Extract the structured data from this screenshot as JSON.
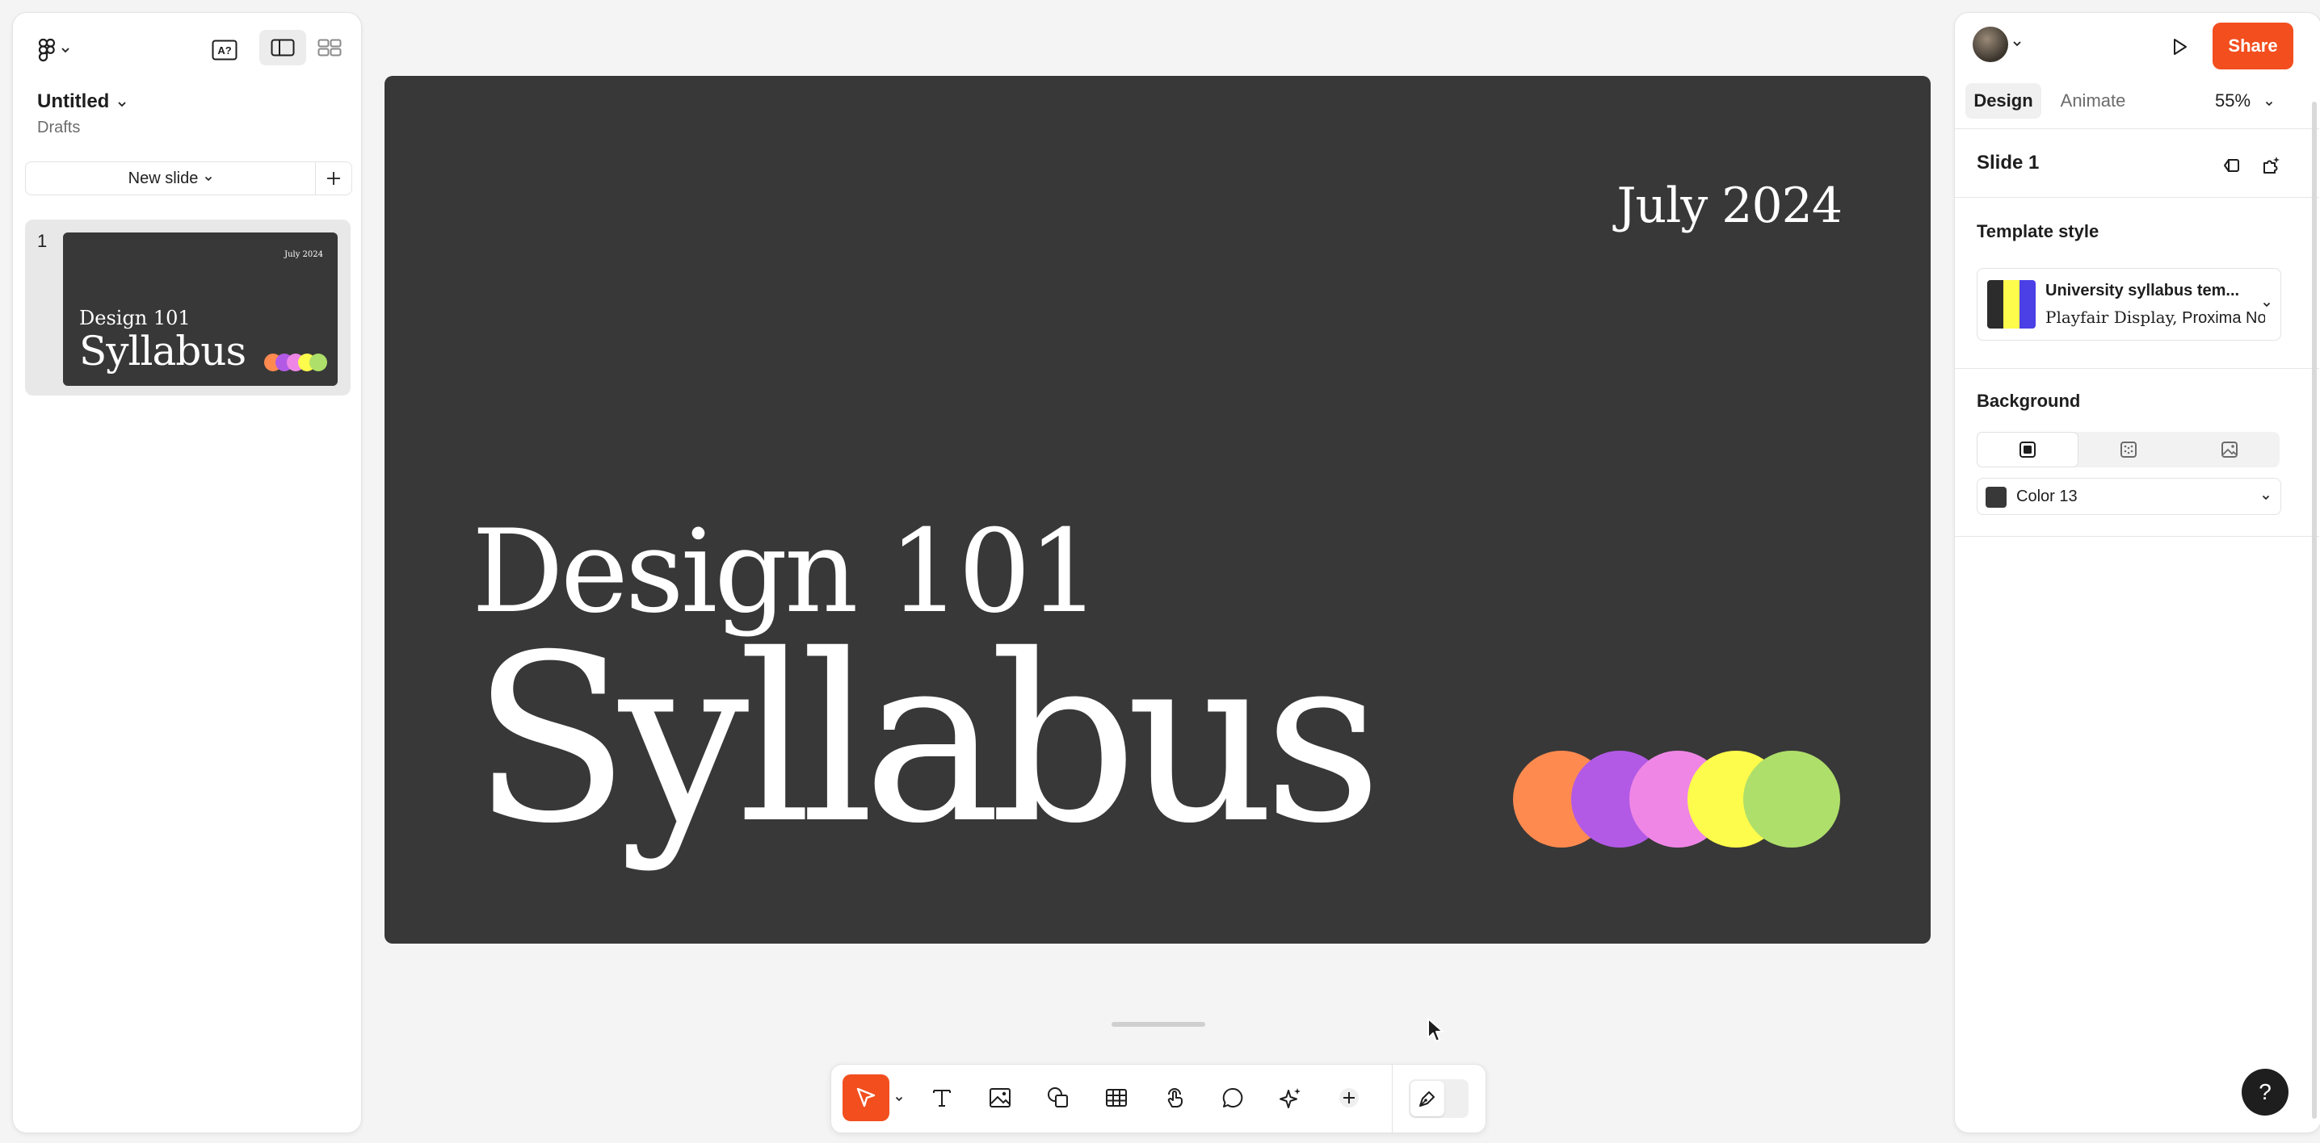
{
  "file": {
    "title": "Untitled",
    "location": "Drafts"
  },
  "left_panel": {
    "new_slide_label": "New slide",
    "slides": [
      {
        "number": "1",
        "date": "July 2024",
        "line1": "Design 101",
        "line2": "Syllabus"
      }
    ]
  },
  "slide": {
    "date": "July 2024",
    "line1": "Design 101",
    "line2": "Syllabus",
    "background": "#383838",
    "dot_colors": [
      "#ff8a50",
      "#b25ae6",
      "#ef86e6",
      "#fdfb4b",
      "#aedf6a"
    ]
  },
  "right_panel": {
    "share_label": "Share",
    "tabs": [
      {
        "label": "Design"
      },
      {
        "label": "Animate"
      }
    ],
    "zoom": "55%",
    "slide_title": "Slide 1",
    "template_section": "Template style",
    "template_name": "University syllabus tem...",
    "template_font_serif": "Playfair Display,",
    "template_font_sans": "Proxima No",
    "template_swatch_colors": [
      "#2c2c2c",
      "#fdfb4b",
      "#4b3fe6"
    ],
    "background_section": "Background",
    "background_color_name": "Color 13",
    "help_label": "?"
  },
  "colors": {
    "accent": "#f24e1e",
    "slide_bg": "#383838"
  }
}
